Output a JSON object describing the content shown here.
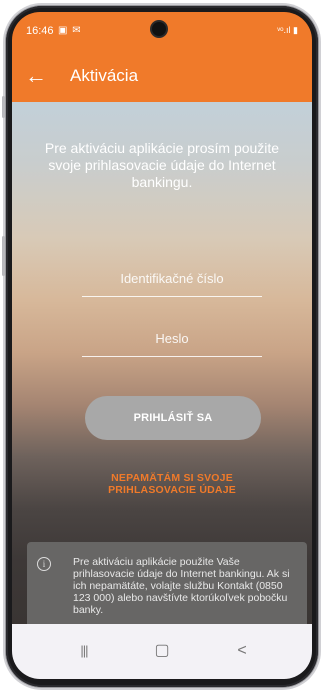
{
  "status_bar": {
    "time": "16:46",
    "notification_icons": "▣ ✉",
    "signal_icons": "ᵛᵒ.ıl ▮"
  },
  "app_bar": {
    "back_icon": "arrow-left",
    "back_glyph": "←",
    "title": "Aktivácia"
  },
  "intro": {
    "text": "Pre aktiváciu aplikácie prosím použite svoje prihlasovacie údaje do Internet bankingu."
  },
  "form": {
    "id_field": {
      "placeholder": "Identifikačné číslo",
      "value": ""
    },
    "password_field": {
      "placeholder": "Heslo",
      "value": ""
    },
    "login_button_label": "PRIHLÁSIŤ SA",
    "forgot_link": "NEPAMÄTÁM SI SVOJE PRIHLASOVACIE ÚDAJE"
  },
  "info_box": {
    "icon_glyph": "i",
    "text": "Pre aktiváciu aplikácie použite Vaše prihlasovacie údaje do Internet bankingu. Ak si ich nepamätáte, volajte službu Kontakt (0850 123 000) alebo navštívte ktorúkoľvek pobočku banky."
  },
  "nav_bar": {
    "recents_glyph": "|||",
    "home_glyph": "▢",
    "back_glyph": "<"
  },
  "colors": {
    "accent": "#f07a2a",
    "button_disabled": "#a8a8a8",
    "info_bg": "#676665"
  }
}
